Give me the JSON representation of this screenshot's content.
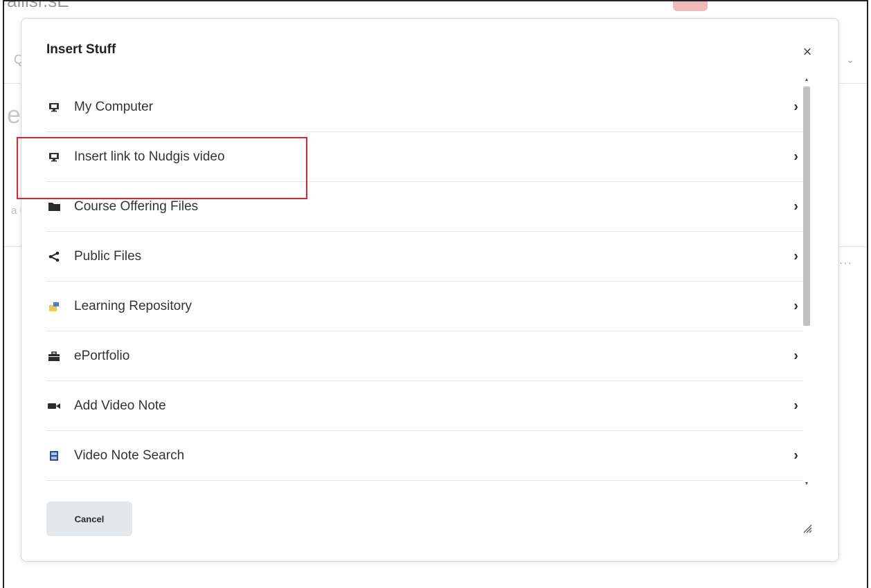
{
  "background": {
    "title_fragment": "alllsr.sE",
    "q_fragment": "Qu",
    "e_fragment": "e",
    "u_fragment": "a U",
    "dots": "···"
  },
  "dialog": {
    "title": "Insert Stuff",
    "close_label": "×",
    "items": [
      {
        "label": "My Computer",
        "icon": "monitor-icon"
      },
      {
        "label": "Insert link to Nudgis video",
        "icon": "monitor-icon"
      },
      {
        "label": "Course Offering Files",
        "icon": "folder-icon"
      },
      {
        "label": "Public Files",
        "icon": "share-icon"
      },
      {
        "label": "Learning Repository",
        "icon": "repository-icon"
      },
      {
        "label": "ePortfolio",
        "icon": "briefcase-icon"
      },
      {
        "label": "Add Video Note",
        "icon": "video-camera-icon"
      },
      {
        "label": "Video Note Search",
        "icon": "video-search-icon"
      }
    ],
    "cancel_label": "Cancel"
  },
  "colors": {
    "highlight": "#e0242c",
    "button_bg": "#e4e7ea"
  }
}
